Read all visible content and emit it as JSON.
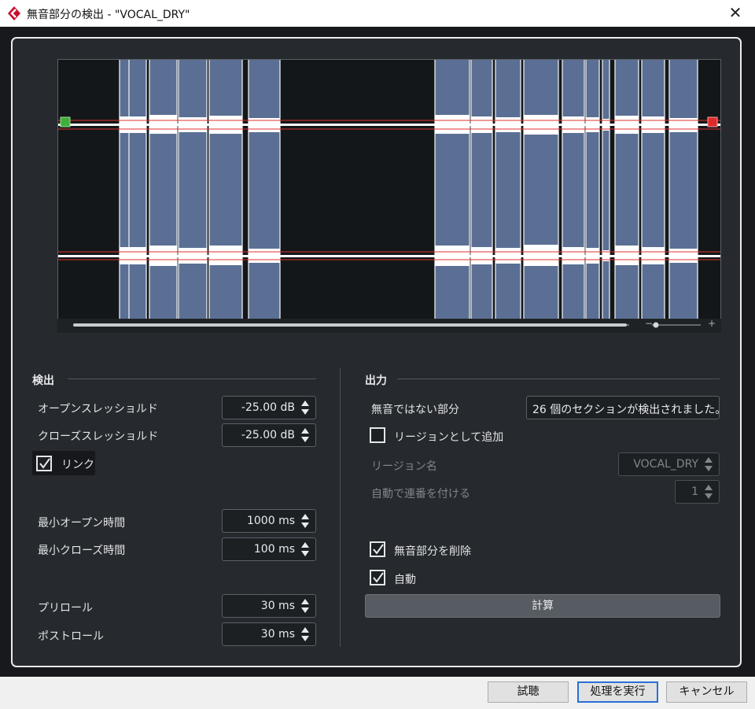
{
  "window": {
    "title": "無音部分の検出 - \"VOCAL_DRY\"",
    "close": "✕"
  },
  "detect": {
    "heading": "検出",
    "open_threshold": {
      "label": "オープンスレッショルド",
      "value": "-25.00 dB"
    },
    "close_threshold": {
      "label": "クローズスレッショルド",
      "value": "-25.00 dB"
    },
    "link": {
      "label": "リンク",
      "checked": true
    },
    "min_open": {
      "label": "最小オープン時間",
      "value": "1000 ms"
    },
    "min_close": {
      "label": "最小クローズ時間",
      "value": "100 ms"
    },
    "preroll": {
      "label": "プリロール",
      "value": "30 ms"
    },
    "postroll": {
      "label": "ポストロール",
      "value": "30 ms"
    }
  },
  "output": {
    "heading": "出力",
    "non_silent": {
      "label": "無音ではない部分",
      "value": "26 個のセクションが検出されました。"
    },
    "add_as_region": {
      "label": "リージョンとして追加",
      "checked": false
    },
    "region_name": {
      "label": "リージョン名",
      "value": "VOCAL_DRY"
    },
    "auto_number": {
      "label": "自動で連番を付ける",
      "value": "1"
    },
    "delete_silence": {
      "label": "無音部分を削除",
      "checked": true
    },
    "auto": {
      "label": "自動",
      "checked": true
    },
    "calc_label": "計算"
  },
  "buttons": {
    "preview": "試聴",
    "process": "処理を実行",
    "cancel": "キャンセル"
  },
  "waveform": {
    "zoom_minus": "−",
    "zoom_plus": "+",
    "sections_hint": "blue shaded regions = detected non-silent sections"
  },
  "colors": {
    "accent": "#2a6fd6",
    "section": "#5a6f93",
    "threshold": "#e03030",
    "start_marker": "#3fae3a",
    "end_marker": "#e02a2a"
  }
}
